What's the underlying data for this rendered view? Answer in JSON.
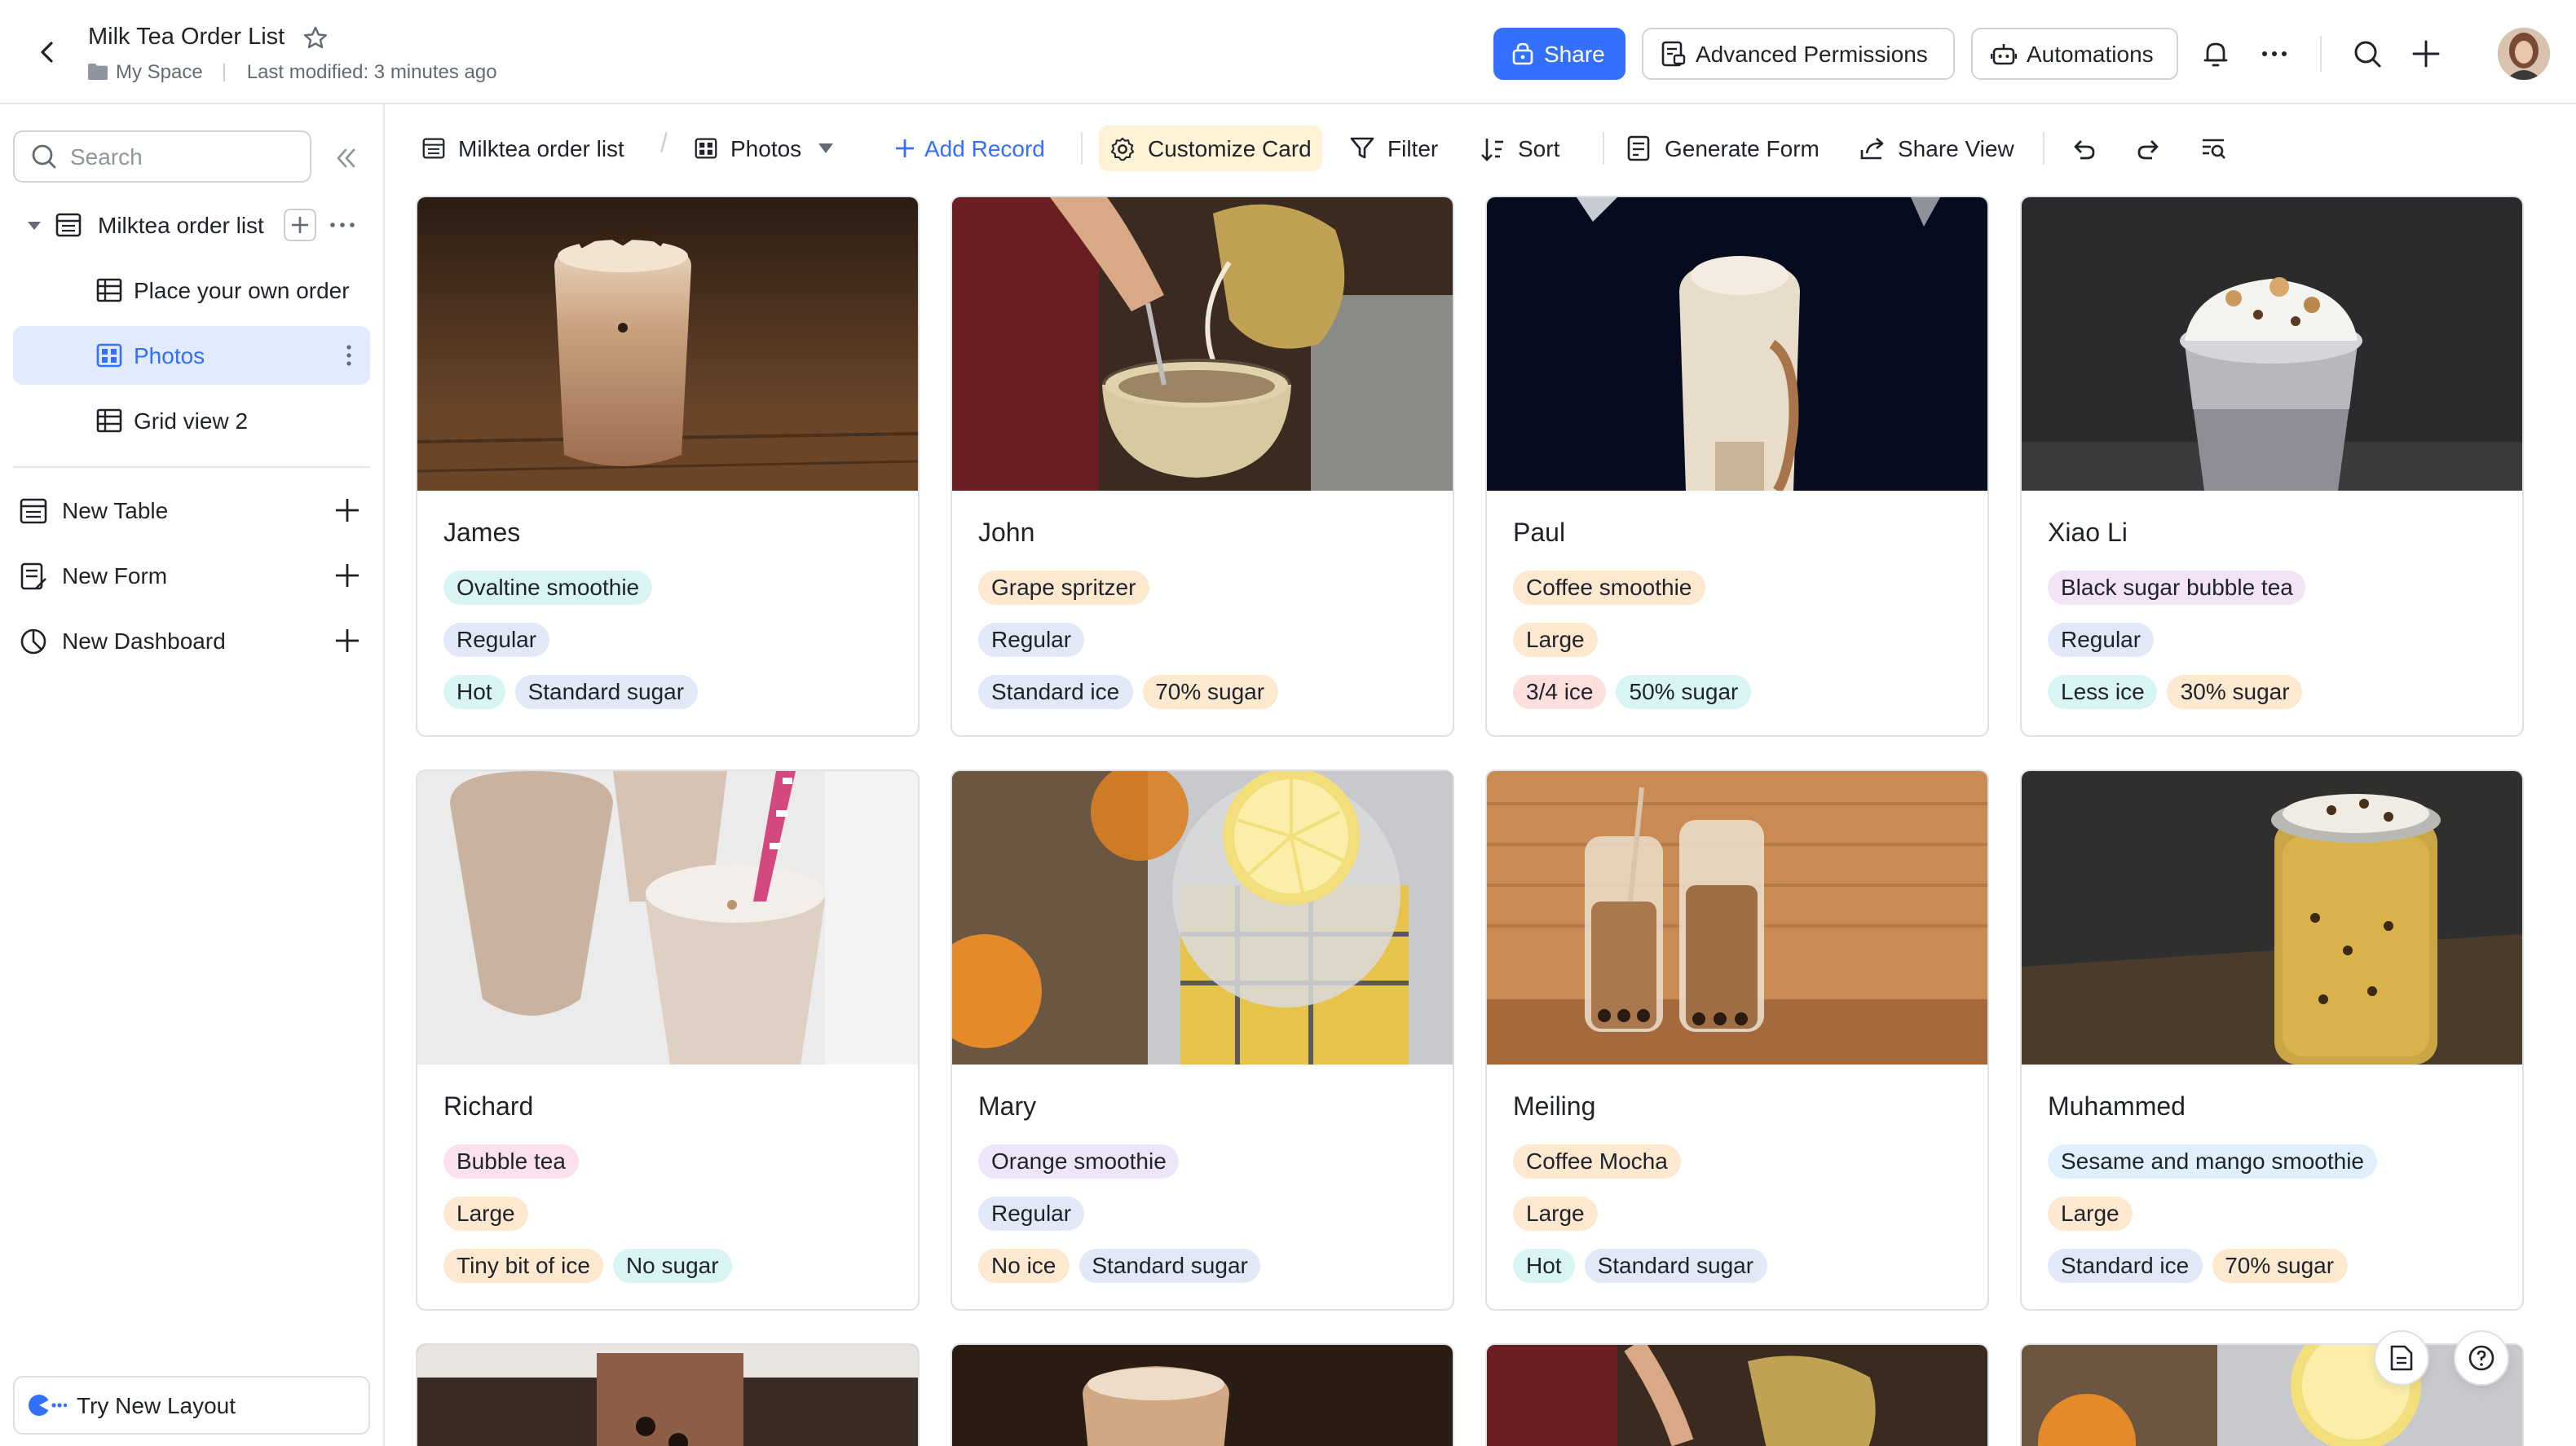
{
  "header": {
    "title": "Milk Tea Order List",
    "location": "My Space",
    "last_modified": "Last modified: 3 minutes ago",
    "share_label": "Share",
    "advanced_permissions_label": "Advanced Permissions",
    "automations_label": "Automations"
  },
  "sidebar": {
    "search_placeholder": "Search",
    "table_name": "Milktea order list",
    "views": [
      {
        "label": "Place your own order",
        "type": "grid"
      },
      {
        "label": "Photos",
        "type": "gallery",
        "active": true
      },
      {
        "label": "Grid view 2",
        "type": "grid"
      }
    ],
    "new_items": [
      {
        "label": "New Table",
        "icon": "table-icon"
      },
      {
        "label": "New Form",
        "icon": "form-icon"
      },
      {
        "label": "New Dashboard",
        "icon": "dashboard-icon"
      }
    ],
    "try_layout_label": "Try New Layout"
  },
  "toolbar": {
    "table_label": "Milktea order list",
    "view_label": "Photos",
    "add_record_label": "Add Record",
    "customize_card_label": "Customize Card",
    "filter_label": "Filter",
    "sort_label": "Sort",
    "generate_form_label": "Generate Form",
    "share_view_label": "Share View"
  },
  "colors": {
    "accent": "#3370ff",
    "active_bg": "#e1eaff",
    "customize_bg": "#fff2d6"
  },
  "cards": [
    {
      "name": "James",
      "drink": "Ovaltine smoothie",
      "size": "Regular",
      "extras": [
        "Hot",
        "Standard sugar"
      ],
      "photo": "milk-tea-cup-on-table"
    },
    {
      "name": "John",
      "drink": "Grape spritzer",
      "size": "Regular",
      "extras": [
        "Standard ice",
        "70% sugar"
      ],
      "photo": "pouring-milk-into-cup"
    },
    {
      "name": "Paul",
      "drink": "Coffee smoothie",
      "size": "Large",
      "extras": [
        "3/4 ice",
        "50% sugar"
      ],
      "photo": "smoothie-dark-background"
    },
    {
      "name": "Xiao Li",
      "drink": "Black sugar bubble tea",
      "size": "Regular",
      "extras": [
        "Less ice",
        "30% sugar"
      ],
      "photo": "cream-topped-drink"
    },
    {
      "name": "Richard",
      "drink": "Bubble tea",
      "size": "Large",
      "extras": [
        "Tiny bit of ice",
        "No sugar"
      ],
      "photo": "milkshake-glasses"
    },
    {
      "name": "Mary",
      "drink": "Orange smoothie",
      "size": "Regular",
      "extras": [
        "No ice",
        "Standard sugar"
      ],
      "photo": "lemon-drink-top-view"
    },
    {
      "name": "Meiling",
      "drink": "Coffee Mocha",
      "size": "Large",
      "extras": [
        "Hot",
        "Standard sugar"
      ],
      "photo": "bubble-tea-bottles"
    },
    {
      "name": "Muhammed",
      "drink": "Sesame and mango smoothie",
      "size": "Large",
      "extras": [
        "Standard ice",
        "70% sugar"
      ],
      "photo": "mango-drink-jar"
    }
  ]
}
